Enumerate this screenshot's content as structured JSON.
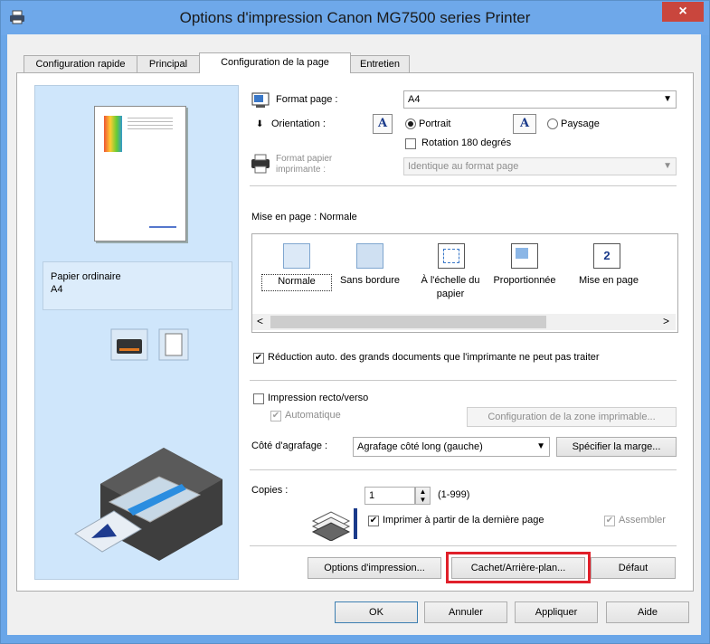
{
  "window": {
    "title": "Options d'impression Canon MG7500 series Printer",
    "close_glyph": "×",
    "app_icon": "printer-icon"
  },
  "tabs": [
    {
      "label": "Configuration rapide"
    },
    {
      "label": "Principal"
    },
    {
      "label": "Configuration de la page"
    },
    {
      "label": "Entretien"
    }
  ],
  "preview": {
    "paper_type": "Papier ordinaire",
    "paper_size": "A4"
  },
  "page_setup": {
    "format_label": "Format page :",
    "format_value": "A4",
    "orientation_label": "Orientation :",
    "portrait_label": "Portrait",
    "landscape_label": "Paysage",
    "orientation_selected": "Portrait",
    "rotate_label": "Rotation 180 degrés",
    "rotate_checked": false,
    "printer_paper_label_1": "Format papier",
    "printer_paper_label_2": "imprimante :",
    "printer_paper_value": "Identique au format page"
  },
  "layout": {
    "header": "Mise en page :  Normale",
    "items": [
      {
        "label": "Normale",
        "icon": "normal-layout-icon"
      },
      {
        "label": "Sans bordure",
        "icon": "borderless-layout-icon"
      },
      {
        "label": "À l'échelle du papier",
        "icon": "fit-to-page-layout-icon"
      },
      {
        "label": "Proportionnée",
        "icon": "scaled-layout-icon"
      },
      {
        "label": "Mise en page",
        "icon": "page-layout-icon"
      }
    ],
    "page_layout_badge": "2",
    "selected": "Normale",
    "scroll_left": "<",
    "scroll_right": ">"
  },
  "options": {
    "auto_reduce_label": "Réduction auto. des grands documents que l'imprimante ne peut pas traiter",
    "auto_reduce_checked": true,
    "duplex_label": "Impression recto/verso",
    "duplex_checked": false,
    "auto_label": "Automatique",
    "auto_checked": true,
    "print_area_button": "Configuration de la zone imprimable...",
    "stapling_label": "Côté d'agrafage :",
    "stapling_value": "Agrafage côté long (gauche)",
    "margin_button": "Spécifier la marge...",
    "copies_label": "Copies :",
    "copies_value": "1",
    "copies_range": "(1-999)",
    "last_page_label": "Imprimer à partir de la dernière page",
    "last_page_checked": true,
    "collate_label": "Assembler",
    "collate_checked": true
  },
  "panel_buttons": {
    "print_options": "Options d'impression...",
    "stamp_background": "Cachet/Arrière-plan...",
    "defaults": "Défaut"
  },
  "dialog_buttons": {
    "ok": "OK",
    "cancel": "Annuler",
    "apply": "Appliquer",
    "help": "Aide"
  },
  "colors": {
    "titlebar": "#6ea8ea",
    "close": "#c9463d",
    "preview_bg": "#cfe6fb",
    "highlight": "#e0202a"
  }
}
